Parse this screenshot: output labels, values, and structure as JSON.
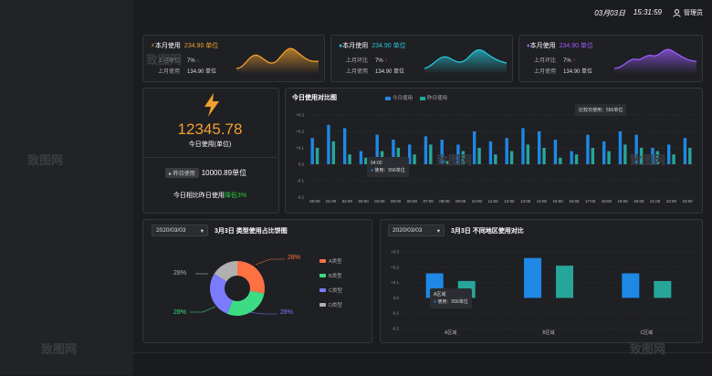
{
  "header": {
    "date": "03月03日",
    "time": "15:31:59",
    "user": "管理员"
  },
  "kpis": [
    {
      "title": "本月使用",
      "value": "234.90 单位",
      "row1_label": "上月环比",
      "row1_value": "7%",
      "row1_dir": "down",
      "row2_label": "上月使用",
      "row2_value": "134.90 单位",
      "color": "#f0a030"
    },
    {
      "title": "本月使用",
      "value": "234.90 单位",
      "row1_label": "上月环比",
      "row1_value": "7%",
      "row1_dir": "up",
      "row2_label": "上月使用",
      "row2_value": "134.90 单位",
      "color": "#26c6da"
    },
    {
      "title": "本月使用",
      "value": "234.90 单位",
      "row1_label": "上月环比",
      "row1_value": "7%",
      "row1_dir": "up",
      "row2_label": "上月使用",
      "row2_value": "134.90 单位",
      "color": "#9c5cff"
    }
  ],
  "today": {
    "value": "12345.78",
    "label": "今日使用(单位)",
    "yesterday_tag": "昨日使用",
    "yesterday_value": "10000.89单位",
    "compare_prefix": "今日相比昨日使用",
    "compare_value": "降低3%"
  },
  "bar_chart": {
    "title": "今日使用对比图",
    "legend": [
      "今日使用",
      "昨日使用"
    ],
    "tooltip1": {
      "title": "04:00",
      "text": "使用：556单位"
    },
    "tooltip2": {
      "text": "比较日使用：556单位"
    }
  },
  "pie_panel": {
    "select": "2020/03/03",
    "title": "3月3日 类型使用占比饼图",
    "labels": [
      "28%",
      "28%",
      "28%",
      "28%"
    ]
  },
  "region_panel": {
    "select": "2020/03/03",
    "title": "3月3日 不同地区使用对比",
    "tooltip_title": "A区域",
    "tooltip_text": "使用：556单位"
  },
  "watermark": "致图网",
  "chart_data": [
    {
      "type": "bar",
      "title": "今日使用对比图",
      "categories": [
        "00:00",
        "01:00",
        "02:00",
        "03:00",
        "04:00",
        "05:00",
        "06:00",
        "07:00",
        "08:00",
        "09:00",
        "10:00",
        "11:00",
        "12:00",
        "13:00",
        "14:00",
        "15:00",
        "16:00",
        "17:00",
        "18:00",
        "19:00",
        "20:00",
        "21:00",
        "22:00",
        "23:00"
      ],
      "ytick_labels": [
        "+0.3",
        "+0.2",
        "+0.1",
        "0.0",
        "-0.1",
        "-0.2"
      ],
      "ylim": [
        -0.2,
        0.3
      ],
      "series": [
        {
          "name": "今日使用",
          "color": "#1e88e5",
          "values": [
            0.16,
            0.24,
            0.22,
            0.08,
            0.18,
            0.15,
            0.12,
            0.17,
            0.15,
            0.12,
            0.2,
            0.14,
            0.16,
            0.22,
            0.2,
            0.15,
            0.08,
            0.18,
            0.14,
            0.2,
            0.18,
            0.1,
            0.12,
            0.16
          ]
        },
        {
          "name": "昨日使用",
          "color": "#26a69a",
          "values": [
            0.1,
            0.14,
            0.06,
            0.04,
            0.08,
            0.1,
            0.06,
            0.12,
            0.02,
            0.08,
            0.1,
            0.06,
            0.08,
            0.12,
            0.1,
            0.04,
            0.06,
            0.1,
            0.08,
            0.12,
            0.1,
            0.08,
            0.06,
            0.1
          ]
        }
      ]
    },
    {
      "type": "pie",
      "title": "3月3日 类型使用占比饼图",
      "categories": [
        "A类型",
        "B类型",
        "C类型",
        "D类型"
      ],
      "values": [
        28,
        28,
        28,
        16
      ],
      "colors": [
        "#ff7043",
        "#3ddc84",
        "#7b7bff",
        "#b0b0b0"
      ]
    },
    {
      "type": "bar",
      "title": "3月3日 不同地区使用对比",
      "categories": [
        "A区域",
        "B区域",
        "C区域"
      ],
      "ytick_labels": [
        "+0.3",
        "+0.2",
        "+0.1",
        "0.0",
        "-0.1",
        "-0.2"
      ],
      "ylim": [
        -0.2,
        0.3
      ],
      "series": [
        {
          "name": "",
          "color": "#1e88e5",
          "values": [
            0.16,
            0.26,
            0.16
          ]
        },
        {
          "name": "",
          "color": "#26a69a",
          "values": [
            0.11,
            0.21,
            0.11
          ]
        }
      ]
    }
  ]
}
